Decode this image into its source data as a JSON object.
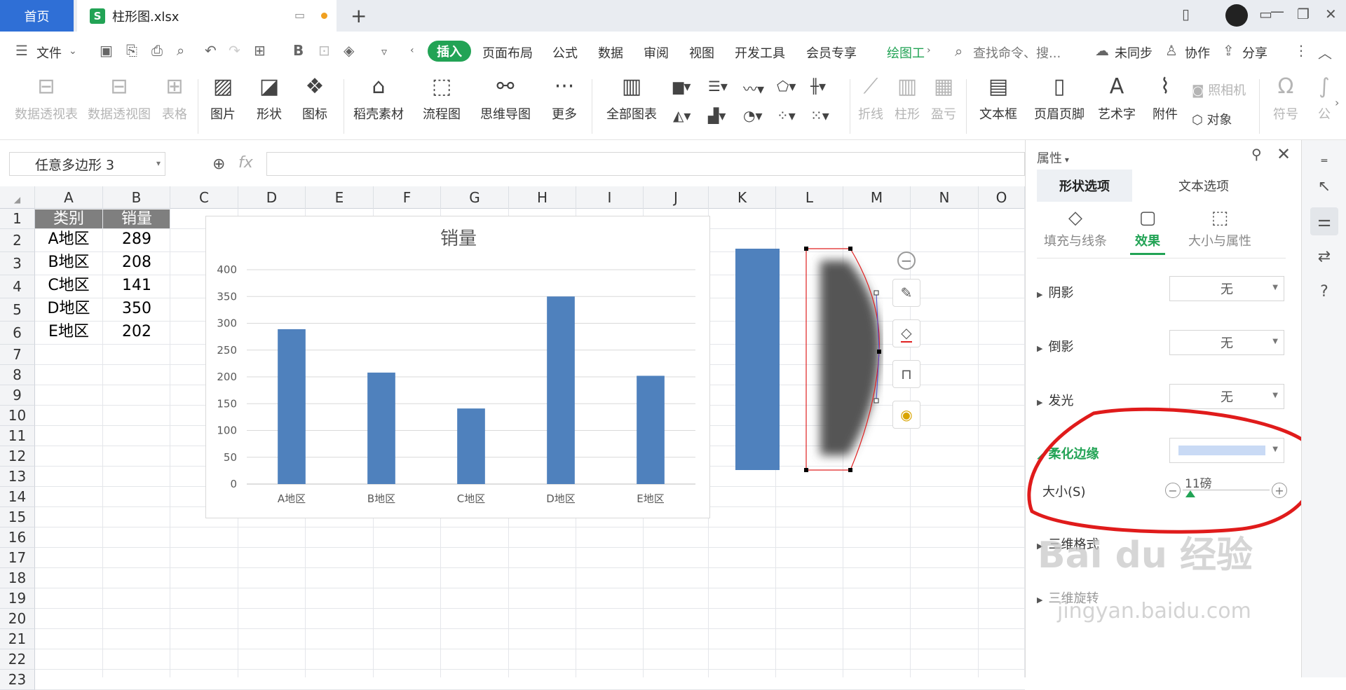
{
  "tabs": {
    "home": "首页",
    "file": "柱形图.xlsx"
  },
  "menu": [
    "文件",
    "插入",
    "页面布局",
    "公式",
    "数据",
    "审阅",
    "视图",
    "开发工具",
    "会员专享"
  ],
  "chart_tools": "绘图工",
  "search_placeholder": "查找命令、搜...",
  "menu_right": {
    "sync": "未同步",
    "collab": "协作",
    "share": "分享"
  },
  "ribbon": [
    {
      "label": "数据透视表",
      "enabled": false
    },
    {
      "label": "数据透视图",
      "enabled": false
    },
    {
      "label": "表格",
      "enabled": false
    },
    {
      "label": "图片",
      "enabled": true
    },
    {
      "label": "形状",
      "enabled": true
    },
    {
      "label": "图标",
      "enabled": true
    },
    {
      "label": "稻壳素材",
      "enabled": true
    },
    {
      "label": "流程图",
      "enabled": true
    },
    {
      "label": "思维导图",
      "enabled": true
    },
    {
      "label": "更多",
      "enabled": true
    },
    {
      "label": "全部图表",
      "enabled": true
    },
    {
      "label": "折线",
      "enabled": false
    },
    {
      "label": "柱形",
      "enabled": false
    },
    {
      "label": "盈亏",
      "enabled": false
    },
    {
      "label": "文本框",
      "enabled": true
    },
    {
      "label": "页眉页脚",
      "enabled": true
    },
    {
      "label": "艺术字",
      "enabled": true
    },
    {
      "label": "附件",
      "enabled": true
    },
    {
      "label": "照相机",
      "enabled": false
    },
    {
      "label": "对象",
      "enabled": true
    },
    {
      "label": "符号",
      "enabled": false
    },
    {
      "label": "公",
      "enabled": false
    }
  ],
  "name_box": "任意多边形 3",
  "fx": "fx",
  "columns": [
    "A",
    "B",
    "C",
    "D",
    "E",
    "F",
    "G",
    "H",
    "I",
    "J",
    "K",
    "L",
    "M",
    "N",
    "O"
  ],
  "rows": [
    "1",
    "2",
    "3",
    "4",
    "5",
    "6",
    "7",
    "8",
    "9",
    "10",
    "11",
    "12",
    "13",
    "14",
    "15",
    "16",
    "17",
    "18",
    "19",
    "20",
    "21",
    "22",
    "23"
  ],
  "table": {
    "headers": [
      "类别",
      "销量"
    ],
    "rows": [
      [
        "A地区",
        "289"
      ],
      [
        "B地区",
        "208"
      ],
      [
        "C地区",
        "141"
      ],
      [
        "D地区",
        "350"
      ],
      [
        "E地区",
        "202"
      ]
    ]
  },
  "chart_data": {
    "type": "bar",
    "title": "销量",
    "categories": [
      "A地区",
      "B地区",
      "C地区",
      "D地区",
      "E地区"
    ],
    "values": [
      289,
      208,
      141,
      350,
      202
    ],
    "ylim": [
      0,
      400
    ],
    "yticks": [
      0,
      50,
      100,
      150,
      200,
      250,
      300,
      350,
      400
    ],
    "grid": true,
    "color": "#4f81bd"
  },
  "panel": {
    "title": "属性",
    "tabs": [
      "形状选项",
      "文本选项"
    ],
    "subtabs": [
      "填充与线条",
      "效果",
      "大小与属性"
    ],
    "props": [
      {
        "label": "阴影",
        "value": "无"
      },
      {
        "label": "倒影",
        "value": "无"
      },
      {
        "label": "发光",
        "value": "无"
      }
    ],
    "soft_edge": "柔化边缘",
    "size_label": "大小(S)",
    "size_value": "11磅",
    "three_d_format": "三维格式",
    "three_d_rotate": "三维旋转"
  },
  "watermark": {
    "brand": "Bai du 经验",
    "url": "jingyan.baidu.com"
  },
  "colors": {
    "accent": "#22a355",
    "tab_blue": "#2f6fd6",
    "annotation": "#e01b1b"
  }
}
